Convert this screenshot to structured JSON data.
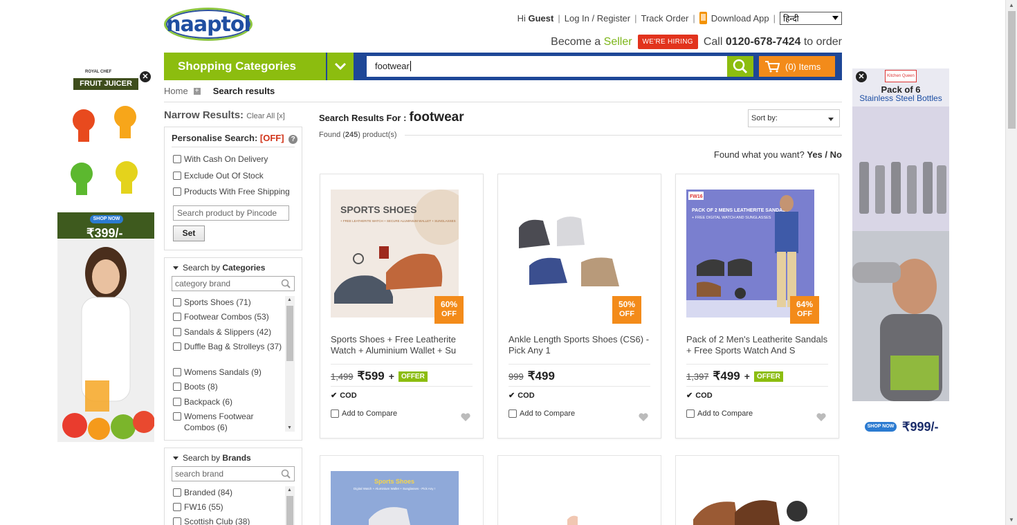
{
  "header": {
    "logo_text": "naaptol",
    "greeting": "Hi",
    "user": "Guest",
    "login": "Log In / Register",
    "track": "Track Order",
    "download": "Download App",
    "language": "हिन्दी",
    "become": "Become a",
    "seller": "Seller",
    "hiring": "WE'RE HIRING",
    "call": "Call",
    "phone": "0120-678-7424",
    "to_order": "to order"
  },
  "nav": {
    "categories": "Shopping Categories",
    "search_value": "footwear",
    "cart": "(0) Items"
  },
  "breadcrumb": {
    "home": "Home",
    "current": "Search results"
  },
  "sidebar": {
    "narrow": "Narrow Results:",
    "clear": "Clear All [x]",
    "personalise": "Personalise Search:",
    "personalise_state": "[OFF]",
    "options": [
      "With Cash On Delivery",
      "Exclude Out Of Stock",
      "Products With Free Shipping"
    ],
    "pincode_placeholder": "Search product by Pincode",
    "set": "Set",
    "categories_title_a": "Search by",
    "categories_title_b": "Categories",
    "category_placeholder": "category brand",
    "categories": [
      "Sports Shoes (71)",
      "Footwear Combos (53)",
      "Sandals & Slippers (42)",
      "Duffle Bag & Strolleys (37)",
      "Womens Sandals (9)",
      "Boots (8)",
      "Backpack (6)",
      "Womens Footwear Combos (6)"
    ],
    "brands_title_a": "Search by",
    "brands_title_b": "Brands",
    "brand_placeholder": "search brand",
    "brands": [
      "Branded (84)",
      "FW16 (55)",
      "Scottish Club (38)"
    ]
  },
  "results": {
    "label": "Search Results For :",
    "query": "footwear",
    "found_a": "Found (",
    "found_count": "245",
    "found_b": ") product(s)",
    "sort": "Sort by:",
    "fww": "Found what you want?",
    "yes": "Yes",
    "slash": "/",
    "no": "No"
  },
  "products": [
    {
      "name": "Sports Shoes + Free Leatherite Watch + Aluminium Wallet + Su",
      "mrp": "1,499",
      "price": "599",
      "discount": "60%",
      "off": "OFF",
      "offer": "OFFER",
      "cod": "COD",
      "compare": "Add to Compare",
      "img_title": "SPORTS SHOES",
      "img_sub": "+ FREE LEATHERITE WATCH + SECURE ALUMINIUM WALLET + SUNGLASSES"
    },
    {
      "name": "Ankle Length Sports Shoes (CS6) - Pick Any 1",
      "mrp": "999",
      "price": "499",
      "discount": "50%",
      "off": "OFF",
      "offer": "",
      "cod": "COD",
      "compare": "Add to Compare"
    },
    {
      "name": "Pack of 2 Men's Leatherite Sandals + Free Sports Watch And S",
      "mrp": "1,397",
      "price": "499",
      "discount": "64%",
      "off": "OFF",
      "offer": "OFFER",
      "cod": "COD",
      "compare": "Add to Compare",
      "img_brand": "FW16",
      "img_title": "PACK OF 2 MENS LEATHERITE SANDALS",
      "img_sub": "+ FREE DIGITAL WATCH AND SUNGLASSES"
    }
  ],
  "row2": [
    {
      "img_title": "Sports Shoes",
      "img_sub": "Digital Watch + Aluminium Wallet + Sunglasses - Pick Any !"
    }
  ],
  "ads": {
    "left_brand": "ROYAL CHEF",
    "left_title": "FRUIT JUICER",
    "left_shop": "SHOP NOW",
    "left_price": "₹399/-",
    "right_brand": "Kitchen Queen",
    "right_title": "Pack of 6",
    "right_sub": "Stainless Steel Bottles",
    "right_shop": "SHOP NOW",
    "right_price": "₹999/-"
  },
  "colors": {
    "green": "#8cbd0f",
    "blue": "#1e4797",
    "orange": "#f38b1a",
    "red": "#e2331d"
  }
}
